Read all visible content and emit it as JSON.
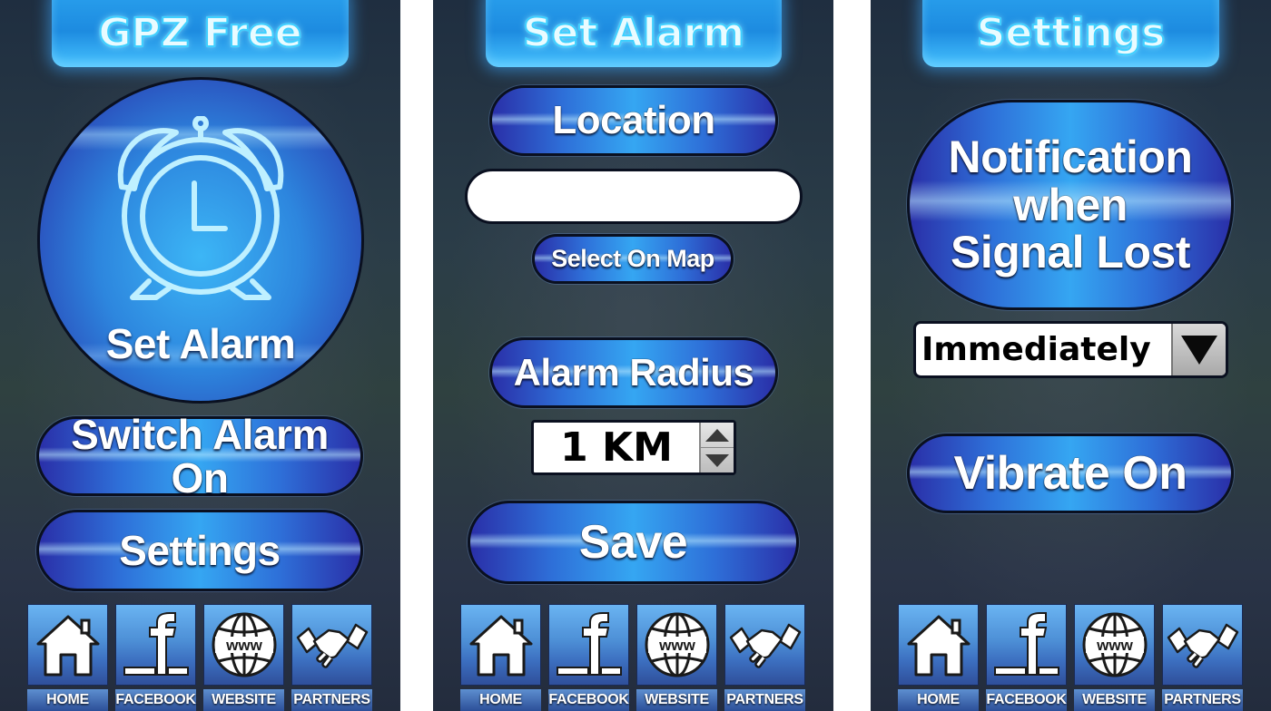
{
  "screens": {
    "home": {
      "title": "GPZ Free",
      "set_alarm_label": "Set Alarm",
      "switch_alarm_label": "Switch Alarm On",
      "settings_label": "Settings"
    },
    "set_alarm": {
      "title": "Set Alarm",
      "location_label": "Location",
      "location_value": "",
      "select_on_map_label": "Select On Map",
      "alarm_radius_label": "Alarm Radius",
      "radius_value": "1 KM",
      "save_label": "Save"
    },
    "settings": {
      "title": "Settings",
      "notification_line1": "Notification",
      "notification_line2": "when",
      "notification_line3": "Signal Lost",
      "notification_option": "Immediately",
      "vibrate_label": "Vibrate On"
    }
  },
  "nav": {
    "home": "HOME",
    "facebook": "FACEBOOK",
    "website": "WEBSITE",
    "partners": "PARTNERS"
  },
  "icons": {
    "alarm": "alarm-clock-icon",
    "home": "house-icon",
    "facebook": "facebook-f-icon",
    "website": "globe-www-icon",
    "partners": "handshake-icon",
    "dropdown": "triangle-down-icon",
    "stepper": "up-down-arrows-icon"
  },
  "colors": {
    "title_glow": "#3fd0ff",
    "pill_center": "#35a6f2",
    "pill_edge": "#2a2fa8",
    "background": "#2b3d48"
  }
}
